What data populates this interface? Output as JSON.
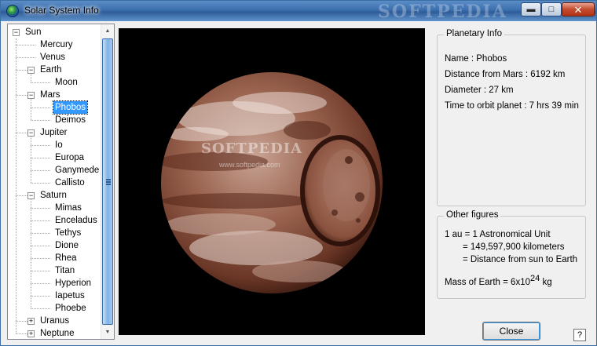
{
  "window": {
    "title": "Solar System Info",
    "watermark": "SOFTPEDIA",
    "controls": {
      "minimize": "▬",
      "maximize": "□",
      "close": "✕"
    }
  },
  "tree": [
    {
      "label": "Sun",
      "level": 0,
      "expander": "−"
    },
    {
      "label": "Mercury",
      "level": 1
    },
    {
      "label": "Venus",
      "level": 1
    },
    {
      "label": "Earth",
      "level": 1,
      "expander": "−"
    },
    {
      "label": "Moon",
      "level": 2
    },
    {
      "label": "Mars",
      "level": 1,
      "expander": "−"
    },
    {
      "label": "Phobos",
      "level": 2,
      "selected": true
    },
    {
      "label": "Deimos",
      "level": 2
    },
    {
      "label": "Jupiter",
      "level": 1,
      "expander": "−"
    },
    {
      "label": "Io",
      "level": 2
    },
    {
      "label": "Europa",
      "level": 2
    },
    {
      "label": "Ganymede",
      "level": 2
    },
    {
      "label": "Callisto",
      "level": 2
    },
    {
      "label": "Saturn",
      "level": 1,
      "expander": "−"
    },
    {
      "label": "Mimas",
      "level": 2
    },
    {
      "label": "Enceladus",
      "level": 2
    },
    {
      "label": "Tethys",
      "level": 2
    },
    {
      "label": "Dione",
      "level": 2
    },
    {
      "label": "Rhea",
      "level": 2
    },
    {
      "label": "Titan",
      "level": 2
    },
    {
      "label": "Hyperion",
      "level": 2
    },
    {
      "label": "Iapetus",
      "level": 2
    },
    {
      "label": "Phoebe",
      "level": 2
    },
    {
      "label": "Uranus",
      "level": 1,
      "expander": "+"
    },
    {
      "label": "Neptune",
      "level": 1,
      "expander": "+"
    }
  ],
  "viewport": {
    "watermark": "SOFTPEDIA",
    "watermark_url": "www.softpedia.com"
  },
  "planetary_info": {
    "title": "Planetary Info",
    "name": "Name : Phobos",
    "distance": "Distance from Mars : 6192 km",
    "diameter": "Diameter : 27 km",
    "orbit": "Time to orbit planet : 7 hrs 39 min"
  },
  "other_figures": {
    "title": "Other figures",
    "au": "1 au = 1 Astronomical Unit",
    "km": "= 149,597,900 kilometers",
    "distance": "= Distance from sun to Earth",
    "mass_prefix": "Mass of Earth = 6x10",
    "mass_exponent": "24",
    "mass_unit": "kg"
  },
  "buttons": {
    "close": "Close",
    "help": "?"
  },
  "colors": {
    "selection": "#3399ff",
    "titlebar": "#3c6fae",
    "moon_base": "#8a5440"
  }
}
